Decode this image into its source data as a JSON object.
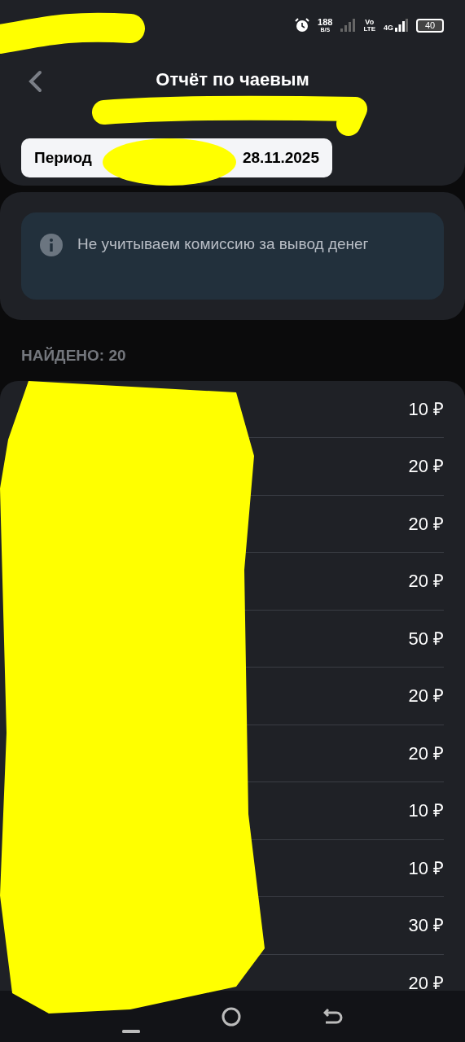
{
  "status_bar": {
    "speed": "188",
    "speed_unit": "B/S",
    "volte_top": "Vo",
    "volte_bottom": "LTE",
    "network": "4G",
    "battery": "40"
  },
  "header": {
    "title": "Отчёт по чаевым",
    "period_label": "Период",
    "period_end": "28.11.2025"
  },
  "notice": {
    "text": "Не учитываем комиссию за вывод денег"
  },
  "found": "НАЙДЕНО: 20",
  "rows": [
    {
      "amount": "10 ₽"
    },
    {
      "amount": "20 ₽"
    },
    {
      "amount": "20 ₽"
    },
    {
      "amount": "20 ₽"
    },
    {
      "amount": "50 ₽"
    },
    {
      "amount": "20 ₽"
    },
    {
      "amount": "20 ₽"
    },
    {
      "amount": "10 ₽"
    },
    {
      "amount": "10 ₽"
    },
    {
      "amount": "30 ₽"
    },
    {
      "amount": "20 ₽"
    }
  ]
}
